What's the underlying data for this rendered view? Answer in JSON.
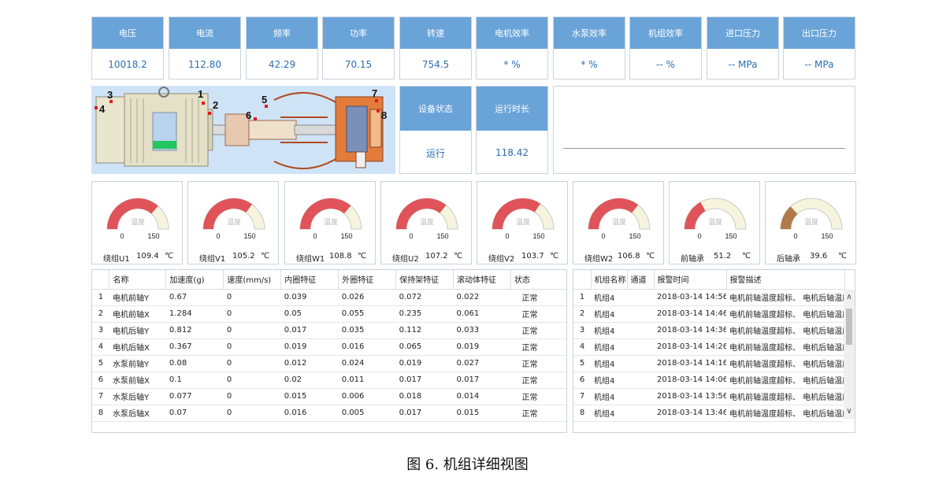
{
  "metrics": [
    {
      "label": "电压",
      "value": "10018.2"
    },
    {
      "label": "电流",
      "value": "112.80"
    },
    {
      "label": "频率",
      "value": "42.29"
    },
    {
      "label": "功率",
      "value": "70.15"
    },
    {
      "label": "转速",
      "value": "754.5"
    },
    {
      "label": "电机效率",
      "value": "* %"
    },
    {
      "label": "水泵效率",
      "value": "* %"
    },
    {
      "label": "机组效率",
      "value": "-- %"
    },
    {
      "label": "进口压力",
      "value": "-- MPa"
    },
    {
      "label": "出口压力",
      "value": "-- MPa"
    }
  ],
  "status": {
    "state_label": "设备状态",
    "state_value": "运行",
    "runtime_label": "运行时长",
    "runtime_value": "118.42"
  },
  "pump_markers": [
    "1",
    "2",
    "3",
    "4",
    "5",
    "6",
    "7",
    "8"
  ],
  "gauges": [
    {
      "name": "绕组U1",
      "value": "109.4",
      "unit": "℃",
      "title": "温度",
      "min": "0",
      "max": "150",
      "level": 109.4,
      "color": "#e05358"
    },
    {
      "name": "绕组V1",
      "value": "105.2",
      "unit": "℃",
      "title": "温度",
      "min": "0",
      "max": "150",
      "level": 105.2,
      "color": "#e05358"
    },
    {
      "name": "绕组W1",
      "value": "108.8",
      "unit": "℃",
      "title": "温度",
      "min": "0",
      "max": "150",
      "level": 108.8,
      "color": "#e05358"
    },
    {
      "name": "绕组U2",
      "value": "107.2",
      "unit": "℃",
      "title": "温度",
      "min": "0",
      "max": "150",
      "level": 107.2,
      "color": "#e05358"
    },
    {
      "name": "绕组V2",
      "value": "103.7",
      "unit": "℃",
      "title": "温度",
      "min": "0",
      "max": "150",
      "level": 103.7,
      "color": "#e05358"
    },
    {
      "name": "绕组W2",
      "value": "106.8",
      "unit": "℃",
      "title": "温度",
      "min": "0",
      "max": "150",
      "level": 106.8,
      "color": "#e05358"
    },
    {
      "name": "前轴承",
      "value": "51.2",
      "unit": "℃",
      "title": "温度",
      "min": "0",
      "max": "150",
      "level": 51.2,
      "color": "#e05358"
    },
    {
      "name": "后轴承",
      "value": "39.6",
      "unit": "℃",
      "title": "温度",
      "min": "0",
      "max": "150",
      "level": 39.6,
      "color": "#b07a4a"
    }
  ],
  "vibration_table": {
    "headers": [
      "",
      "名称",
      "加速度(g)",
      "速度(mm/s)",
      "内圈特征",
      "外圈特征",
      "保持架特征",
      "滚动体特征",
      "状态"
    ],
    "rows": [
      [
        "1",
        "电机前轴Y",
        "0.67",
        "0",
        "0.039",
        "0.026",
        "0.072",
        "0.022",
        "正常"
      ],
      [
        "2",
        "电机前轴X",
        "1.284",
        "0",
        "0.05",
        "0.055",
        "0.235",
        "0.061",
        "正常"
      ],
      [
        "3",
        "电机后轴Y",
        "0.812",
        "0",
        "0.017",
        "0.035",
        "0.112",
        "0.033",
        "正常"
      ],
      [
        "4",
        "电机后轴X",
        "0.367",
        "0",
        "0.019",
        "0.016",
        "0.065",
        "0.019",
        "正常"
      ],
      [
        "5",
        "水泵前轴Y",
        "0.08",
        "0",
        "0.012",
        "0.024",
        "0.019",
        "0.027",
        "正常"
      ],
      [
        "6",
        "水泵前轴X",
        "0.1",
        "0",
        "0.02",
        "0.011",
        "0.017",
        "0.017",
        "正常"
      ],
      [
        "7",
        "水泵后轴Y",
        "0.077",
        "0",
        "0.015",
        "0.006",
        "0.018",
        "0.014",
        "正常"
      ],
      [
        "8",
        "水泵后轴X",
        "0.07",
        "0",
        "0.016",
        "0.005",
        "0.017",
        "0.015",
        "正常"
      ]
    ]
  },
  "alarm_table": {
    "headers": [
      "",
      "机组名称",
      "通道",
      "报警时间",
      "报警描述"
    ],
    "rows": [
      [
        "1",
        "机组4",
        "",
        "2018-03-14 14:56:",
        "电机前轴温度超标、 电机后轴温度超"
      ],
      [
        "2",
        "机组4",
        "",
        "2018-03-14 14:46:",
        "电机前轴温度超标、 电机后轴温度超"
      ],
      [
        "3",
        "机组4",
        "",
        "2018-03-14 14:36:",
        "电机前轴温度超标、 电机后轴温度超"
      ],
      [
        "4",
        "机组4",
        "",
        "2018-03-14 14:26:",
        "电机前轴温度超标、 电机后轴温度超"
      ],
      [
        "5",
        "机组4",
        "",
        "2018-03-14 14:16:",
        "电机前轴温度超标、 电机后轴温度超"
      ],
      [
        "6",
        "机组4",
        "",
        "2018-03-14 14:06:",
        "电机前轴温度超标、 电机后轴温度超"
      ],
      [
        "7",
        "机组4",
        "",
        "2018-03-14 13:56:",
        "电机前轴温度超标、 电机后轴温度超"
      ],
      [
        "8",
        "机组4",
        "",
        "2018-03-14 13:46:",
        "电机前轴温度超标、 电机后轴温度超"
      ]
    ]
  },
  "caption": "图 6. 机组详细视图"
}
